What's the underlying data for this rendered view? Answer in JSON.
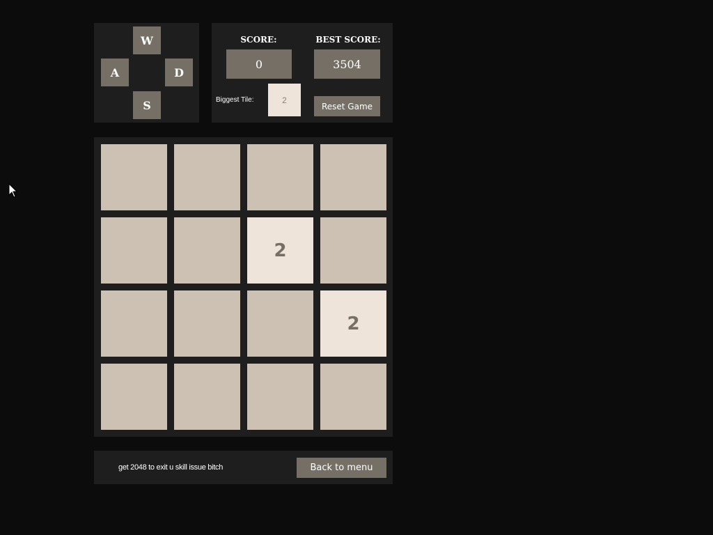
{
  "controls": {
    "up": "W",
    "left": "A",
    "right": "D",
    "down": "S"
  },
  "scoreboard": {
    "score_label": "SCORE:",
    "score_value": "0",
    "best_label": "BEST SCORE:",
    "best_value": "3504",
    "biggest_tile_label": "Biggest Tile:",
    "biggest_tile_value": "2",
    "reset_label": "Reset Game"
  },
  "board": {
    "size": 4,
    "cells": [
      [
        "",
        "",
        "",
        ""
      ],
      [
        "",
        "",
        "2",
        ""
      ],
      [
        "",
        "",
        "",
        "2"
      ],
      [
        "",
        "",
        "",
        ""
      ]
    ]
  },
  "footer": {
    "message": "get 2048 to exit u skill issue bitch",
    "menu_label": "Back to menu"
  },
  "colors": {
    "background": "#0c0c0c",
    "panel": "#1e1e1e",
    "button": "#756f65",
    "empty_tile": "#cdc1b4",
    "tile_2": "#eee4da",
    "tile_text": "#776e65"
  },
  "icons": {
    "cursor": "mouse-pointer-icon"
  }
}
